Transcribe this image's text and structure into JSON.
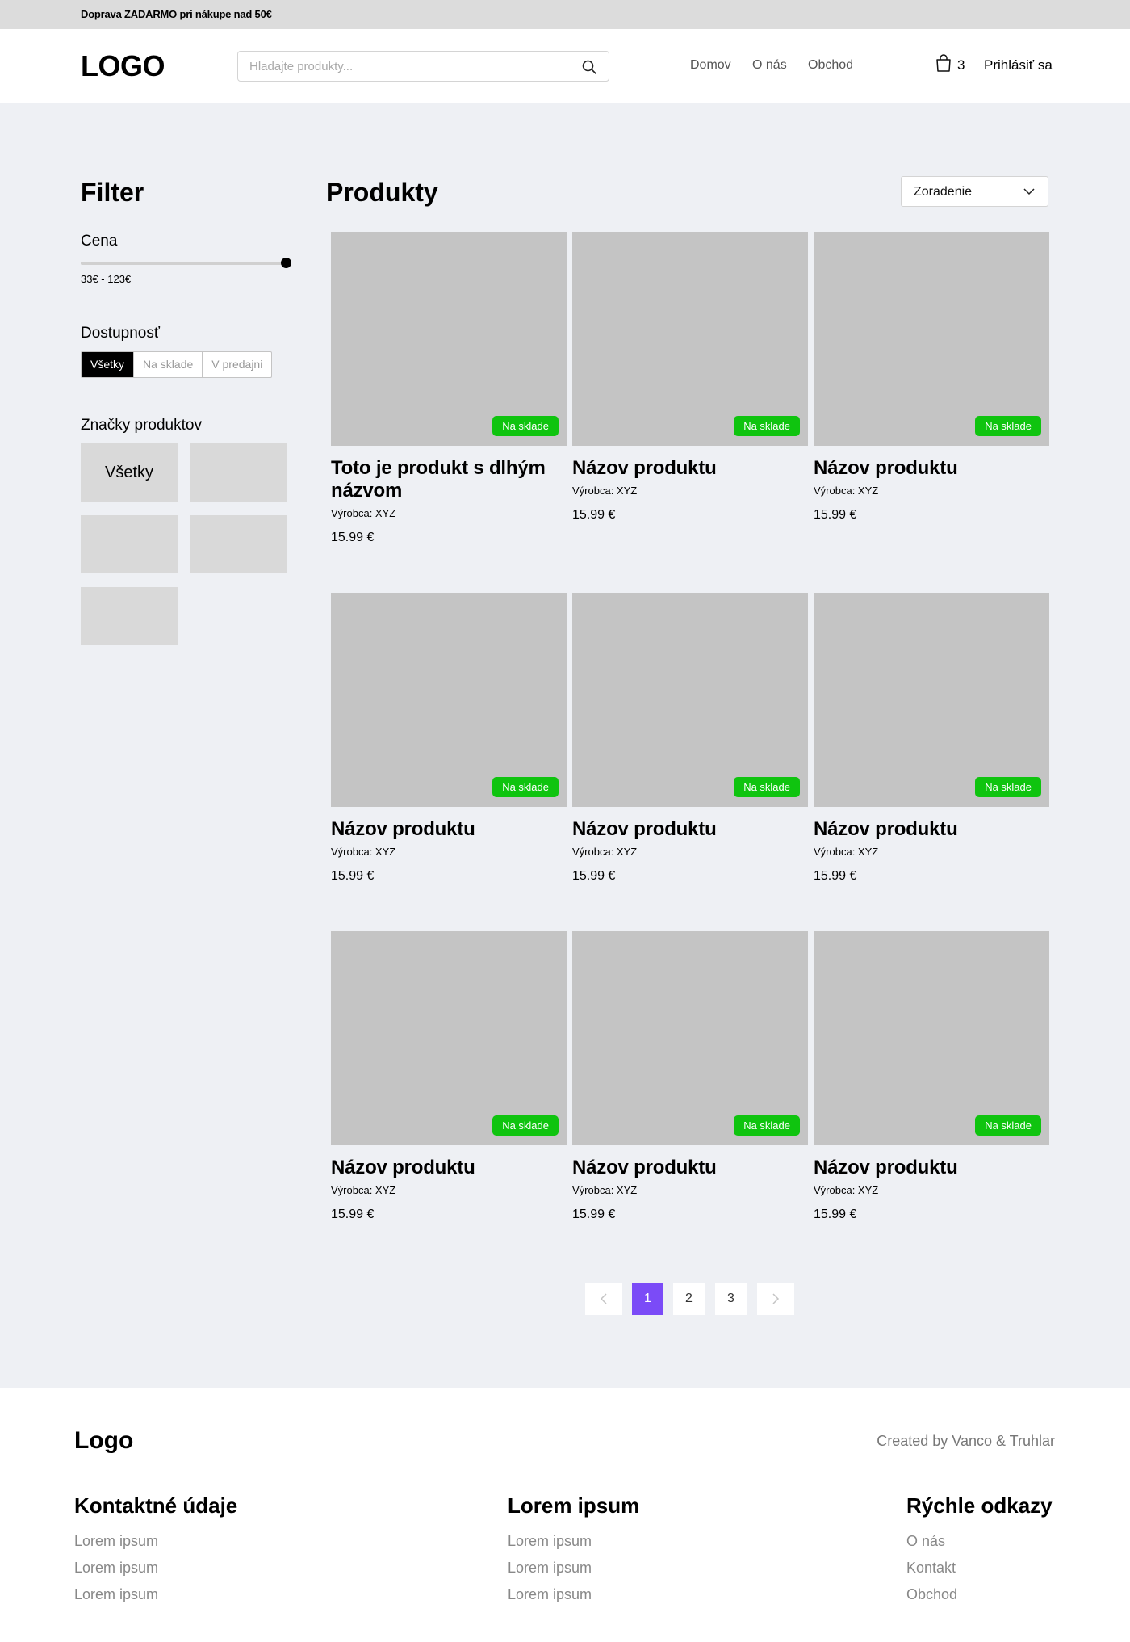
{
  "promo": {
    "text": "Doprava ZADARMO pri  nákupe nad 50€"
  },
  "header": {
    "logo": "LOGO",
    "search_placeholder": "Hladajte produkty...",
    "nav": [
      "Domov",
      "O nás",
      "Obchod"
    ],
    "cart_count": "3",
    "login": "Prihlásiť sa"
  },
  "filter": {
    "title": "Filter",
    "price_label": "Cena",
    "price_range": "33€ - 123€",
    "price_slider_level": 1.0,
    "availability_label": "Dostupnosť",
    "availability_options": [
      "Všetky",
      "Na sklade",
      "V predajni"
    ],
    "availability_selected": "Všetky",
    "brands_label": "Značky produktov",
    "brand_all": "Všetky"
  },
  "products": {
    "title": "Produkty",
    "sort_label": "Zoradenie",
    "items": [
      {
        "name": "Toto je produkt s dlhým názvom",
        "maker": "Výrobca: XYZ",
        "price": "15.99 €",
        "badge": "Na sklade"
      },
      {
        "name": "Názov produktu",
        "maker": "Výrobca: XYZ",
        "price": "15.99 €",
        "badge": "Na sklade"
      },
      {
        "name": "Názov produktu",
        "maker": "Výrobca: XYZ",
        "price": "15.99 €",
        "badge": "Na sklade"
      },
      {
        "name": "Názov produktu",
        "maker": "Výrobca: XYZ",
        "price": "15.99 €",
        "badge": "Na sklade"
      },
      {
        "name": "Názov produktu",
        "maker": "Výrobca: XYZ",
        "price": "15.99 €",
        "badge": "Na sklade"
      },
      {
        "name": "Názov produktu",
        "maker": "Výrobca: XYZ",
        "price": "15.99 €",
        "badge": "Na sklade"
      },
      {
        "name": "Názov produktu",
        "maker": "Výrobca: XYZ",
        "price": "15.99 €",
        "badge": "Na sklade"
      },
      {
        "name": "Názov produktu",
        "maker": "Výrobca: XYZ",
        "price": "15.99 €",
        "badge": "Na sklade"
      },
      {
        "name": "Názov produktu",
        "maker": "Výrobca: XYZ",
        "price": "15.99 €",
        "badge": "Na sklade"
      }
    ]
  },
  "pagination": {
    "pages": [
      "1",
      "2",
      "3"
    ],
    "current": "1",
    "prev_icon": "chevron-left-icon",
    "next_icon": "chevron-right-icon"
  },
  "footer": {
    "logo": "Logo",
    "credit": "Created by Vanco & Truhlar",
    "columns": [
      {
        "title": "Kontaktné údaje",
        "links": [
          "Lorem ipsum",
          "Lorem ipsum",
          "Lorem ipsum"
        ]
      },
      {
        "title": "Lorem ipsum",
        "links": [
          "Lorem ipsum",
          "Lorem ipsum",
          "Lorem ipsum"
        ]
      },
      {
        "title": "Rýchle odkazy",
        "links": [
          "O nás",
          "Kontakt",
          "Obchod"
        ]
      }
    ]
  },
  "colors": {
    "accent": "#7b4bf7",
    "badge": "#0fc40f",
    "main_bg": "#eef0f4",
    "placeholder_img": "#c4c4c4"
  }
}
